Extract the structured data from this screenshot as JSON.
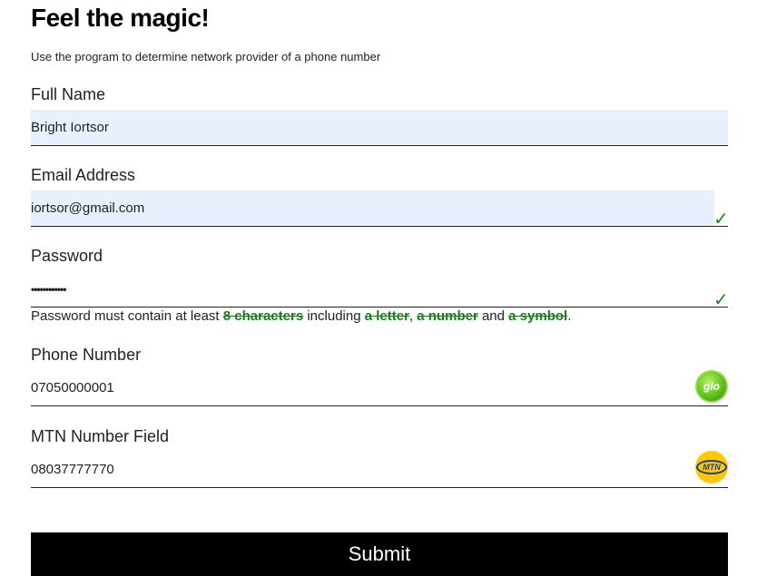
{
  "page": {
    "title": "Feel the magic!",
    "subtitle": "Use the program to determine network provider of a phone number"
  },
  "form": {
    "full_name": {
      "label": "Full Name",
      "value": "Bright Iortsor"
    },
    "email": {
      "label": "Email Address",
      "value": "iortsor@gmail.com",
      "valid": true
    },
    "password": {
      "label": "Password",
      "value": "••••••••••••",
      "valid": true
    },
    "password_hint": {
      "prefix": "Password must contain at least ",
      "req_length": "8 characters",
      "mid1": " including ",
      "req_letter": "a letter",
      "sep": ", ",
      "req_number": "a number",
      "mid2": " and ",
      "req_symbol": "a symbol",
      "suffix": "."
    },
    "phone": {
      "label": "Phone Number",
      "value": "07050000001",
      "provider_logo": "glo"
    },
    "mtn_number": {
      "label": "MTN Number Field",
      "value": "08037777770",
      "provider_logo": "MTN"
    },
    "submit_label": "Submit"
  },
  "colors": {
    "autofill_bg": "#e8f0fe",
    "valid_green": "#1f8a1f",
    "button_bg": "#000000"
  }
}
